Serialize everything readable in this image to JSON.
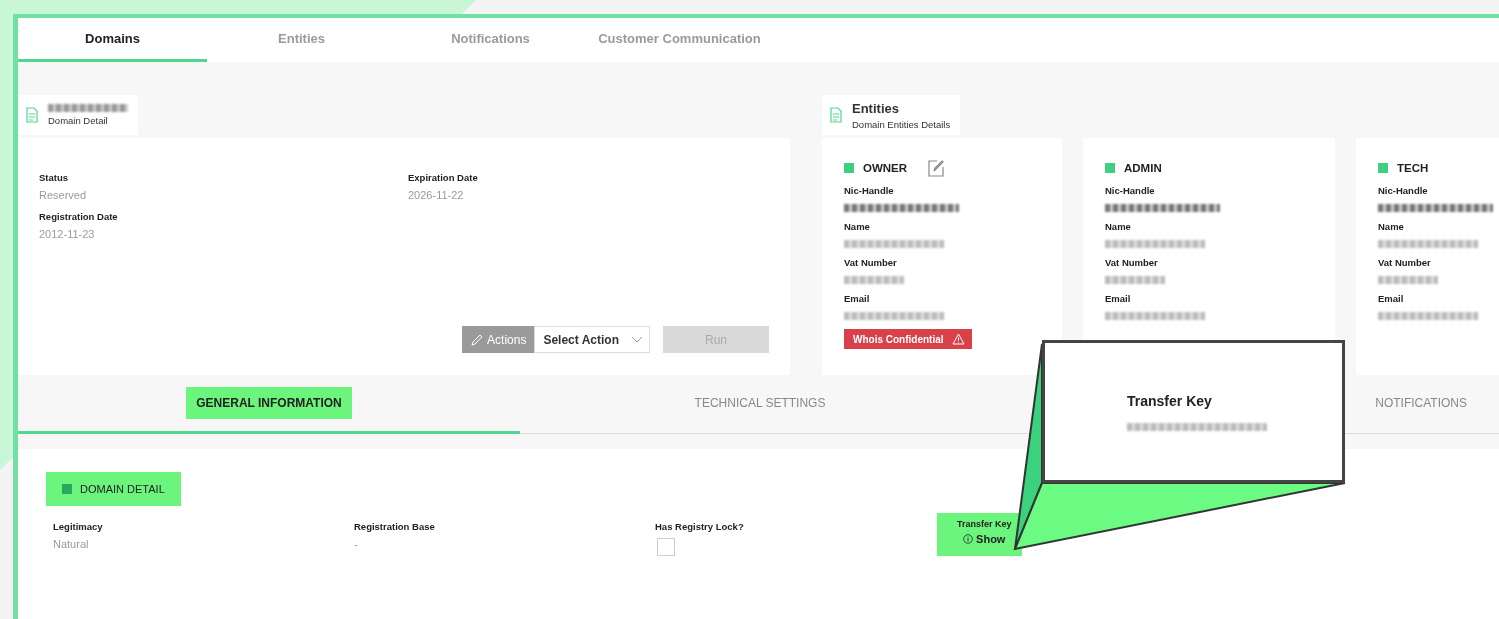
{
  "tabs": [
    {
      "label": "Domains",
      "selected": true
    },
    {
      "label": "Entities",
      "selected": false
    },
    {
      "label": "Notifications",
      "selected": false
    },
    {
      "label": "Customer Communication",
      "selected": false
    }
  ],
  "domain_panel": {
    "title_blurred": true,
    "subtitle": "Domain Detail",
    "fields": [
      {
        "label": "Status",
        "value": "Reserved"
      },
      {
        "label": "Expiration Date",
        "value": "2026-11-22"
      },
      {
        "label": "Registration Date",
        "value": "2012-11-23"
      }
    ],
    "actions_label": "Actions",
    "select_label": "Select Action",
    "run": {
      "label": "Run",
      "disabled": true
    }
  },
  "entities_panel": {
    "title": "Entities",
    "subtitle": "Domain Entities Details",
    "entities": [
      {
        "role": "OWNER",
        "editable": true,
        "badge": "Whois Confidential",
        "fields": [
          {
            "label": "Nic-Handle",
            "blurred": true,
            "kind": "handle"
          },
          {
            "label": "Name",
            "blurred": true,
            "kind": "faint"
          },
          {
            "label": "Vat Number",
            "blurred": true,
            "kind": "short"
          },
          {
            "label": "Email",
            "blurred": true,
            "kind": "faint"
          }
        ]
      },
      {
        "role": "ADMIN",
        "editable": false,
        "fields": [
          {
            "label": "Nic-Handle",
            "blurred": true,
            "kind": "handle"
          },
          {
            "label": "Name",
            "blurred": true,
            "kind": "faint"
          },
          {
            "label": "Vat Number",
            "blurred": true,
            "kind": "short"
          },
          {
            "label": "Email",
            "blurred": true,
            "kind": "faint"
          }
        ]
      },
      {
        "role": "TECH",
        "editable": false,
        "fields": [
          {
            "label": "Nic-Handle",
            "blurred": true,
            "kind": "handle"
          },
          {
            "label": "Name",
            "blurred": true,
            "kind": "faint"
          },
          {
            "label": "Vat Number",
            "blurred": true,
            "kind": "short"
          },
          {
            "label": "Email",
            "blurred": true,
            "kind": "faint"
          }
        ]
      }
    ]
  },
  "section_tabs": [
    {
      "label": "GENERAL INFORMATION",
      "selected": true,
      "highlighted": true
    },
    {
      "label": "TECHNICAL SETTINGS",
      "selected": false,
      "highlighted": false
    },
    {
      "label": "NOTIFICATIONS",
      "selected": false,
      "highlighted": false
    }
  ],
  "section": {
    "title": "DOMAIN DETAIL",
    "highlighted": true,
    "fields": [
      {
        "kind": "text",
        "label": "Legitimacy",
        "value": "Natural"
      },
      {
        "kind": "text",
        "label": "Registration Base",
        "value": "-"
      },
      {
        "kind": "checkbox",
        "label": "Has Registry Lock?",
        "checked": false
      },
      {
        "kind": "reveal",
        "label": "Transfer Key",
        "action": "Show",
        "highlighted": true
      }
    ]
  },
  "callout": {
    "title": "Transfer Key",
    "value_blurred": true
  }
}
